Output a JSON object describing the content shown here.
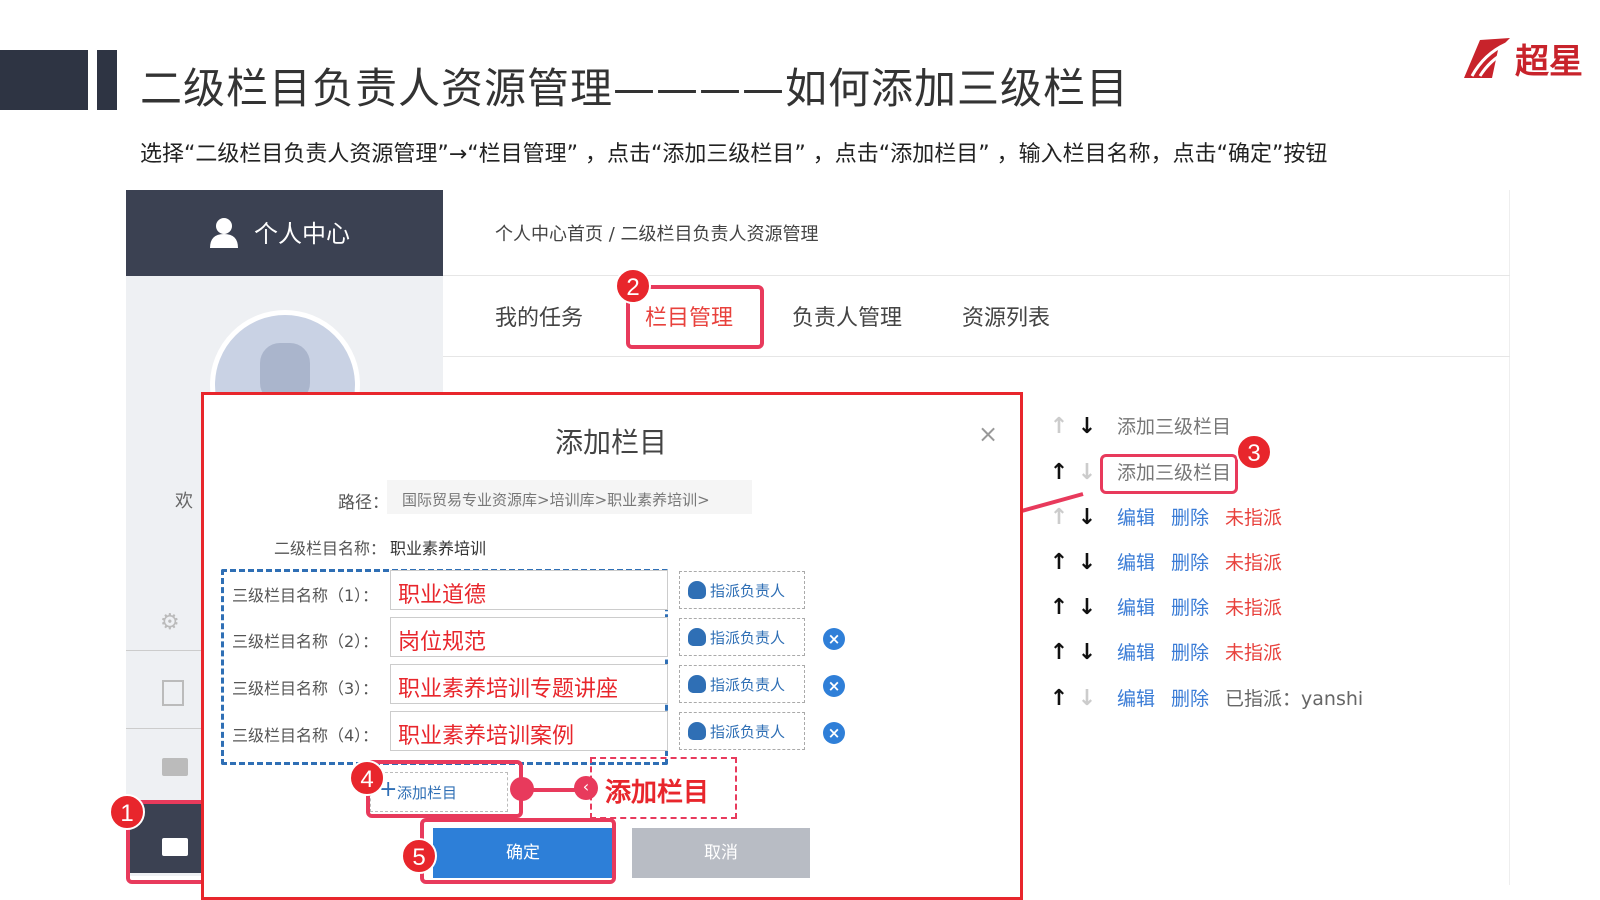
{
  "slide": {
    "title": "二级栏目负责人资源管理————如何添加三级栏目",
    "instruction": "选择“二级栏目负责人资源管理”→“栏目管理”  ，点击“添加三级栏目”  ，点击“添加栏目”  ，输入栏目名称，点击“确定”按钮",
    "logo_text": "超星"
  },
  "sidebar": {
    "header_label": "个人中心",
    "welcome": "欢"
  },
  "breadcrumb": "个人中心首页 / 二级栏目负责人资源管理",
  "tabs": [
    {
      "label": "我的任务"
    },
    {
      "label": "栏目管理"
    },
    {
      "label": "负责人管理"
    },
    {
      "label": "资源列表"
    }
  ],
  "column_rows": [
    {
      "action": "添加三级栏目"
    },
    {
      "action": "添加三级栏目"
    },
    {
      "edit": "编辑",
      "delete": "删除",
      "status": "未指派"
    },
    {
      "edit": "编辑",
      "delete": "删除",
      "status": "未指派"
    },
    {
      "edit": "编辑",
      "delete": "删除",
      "status": "未指派"
    },
    {
      "edit": "编辑",
      "delete": "删除",
      "status": "未指派"
    },
    {
      "edit": "编辑",
      "delete": "删除",
      "status": "已指派：yanshi"
    }
  ],
  "dialog": {
    "title": "添加栏目",
    "close": "×",
    "path_label": "路径：",
    "path_value": "国际贸易专业资源库>培训库>职业素养培训>",
    "level2_label": "二级栏目名称：",
    "level2_value": "职业素养培训",
    "fields": [
      {
        "label": "三级栏目名称（1）：",
        "value": "职业道德"
      },
      {
        "label": "三级栏目名称（2）：",
        "value": "岗位规范"
      },
      {
        "label": "三级栏目名称（3）：",
        "value": "职业素养培训专题讲座"
      },
      {
        "label": "三级栏目名称（4）：",
        "value": "职业素养培训案例"
      }
    ],
    "assign_label": "指派负责人",
    "add_column": "添加栏目",
    "ok": "确定",
    "cancel": "取消"
  },
  "callout": "添加栏目",
  "markers": [
    "1",
    "2",
    "3",
    "4",
    "5"
  ],
  "colors": {
    "highlight": "#e83a5c",
    "dark": "#3b4152",
    "link": "#3a7cd6",
    "primary_button": "#2d7fd8"
  }
}
